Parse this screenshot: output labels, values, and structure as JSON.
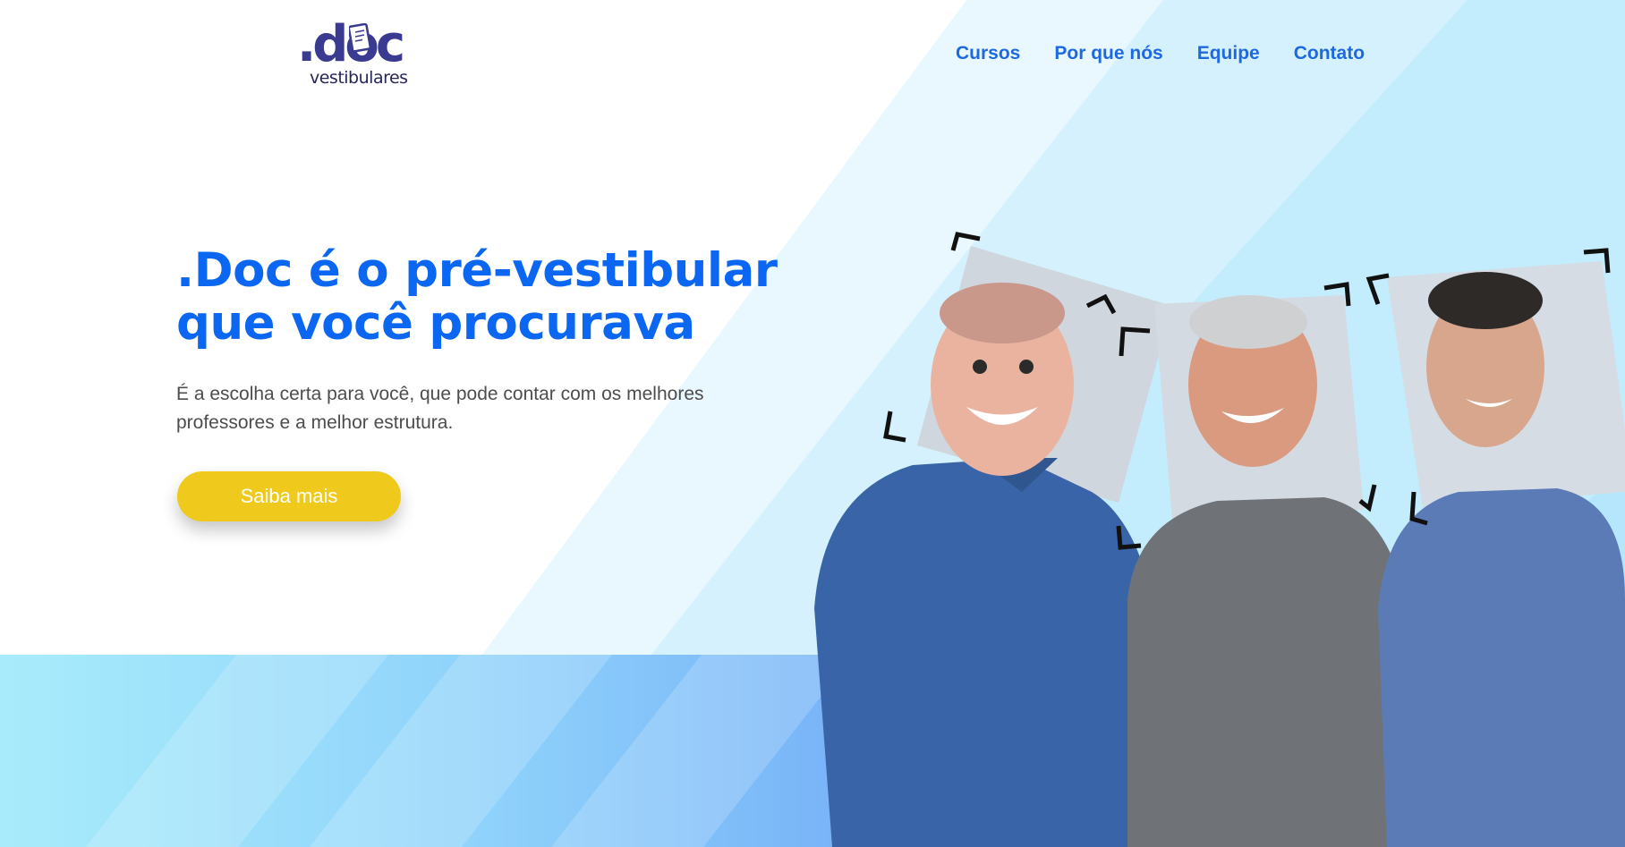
{
  "brand": {
    "logo_mark": ".doc",
    "logo_sub": "vestibulares"
  },
  "nav": {
    "items": [
      "Cursos",
      "Por que nós",
      "Equipe",
      "Contato"
    ]
  },
  "hero": {
    "title_line1": ".Doc é o pré-vestibular",
    "title_line2": "que você procurava",
    "subtitle_line1": "É a escolha certa para você, que pode contar com os melhores",
    "subtitle_line2": "professores e a melhor estrutura.",
    "cta_label": "Saiba mais"
  },
  "colors": {
    "accent_blue": "#0b67f2",
    "nav_blue": "#1d69e0",
    "cta_yellow": "#efca1d",
    "logo_purple": "#3a3a91",
    "background_light_blue": "#c6eefc"
  },
  "icons": {
    "logo_icon": "document-icon",
    "frame_corners": "viewfinder-corner-icon"
  }
}
